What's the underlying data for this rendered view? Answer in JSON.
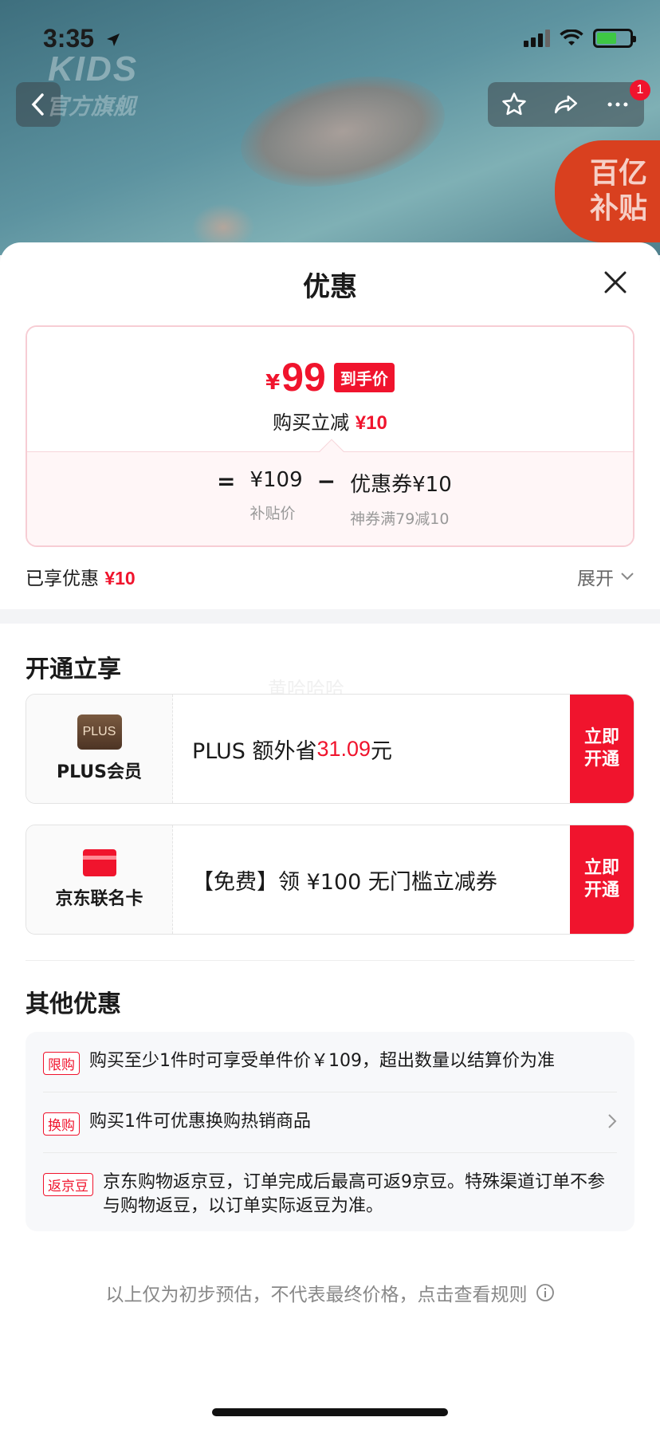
{
  "status_bar": {
    "time": "3:35"
  },
  "background": {
    "brand_text": "KIDS",
    "store_name": "官方旗舰",
    "notification_count": "1",
    "subsidy_badge": [
      "百亿",
      "补贴"
    ]
  },
  "sheet": {
    "title": "优惠",
    "price_card": {
      "yen": "¥",
      "final_price": "99",
      "final_tag": "到手价",
      "instant_cut_label": "购买立减",
      "instant_cut_value": "¥10",
      "equals": "=",
      "base_price": "¥109",
      "base_price_label": "补贴价",
      "minus": "−",
      "coupon": "优惠券¥10",
      "coupon_label": "神券满79减10"
    },
    "enjoyed": {
      "label": "已享优惠",
      "value": "¥10"
    },
    "expand_label": "展开",
    "open_section": {
      "title": "开通立享",
      "watermark": "黄哈哈哈",
      "cards": [
        {
          "name": "PLUS会员",
          "logo_text": "PLUS",
          "desc_pre": "PLUS 额外省 ",
          "desc_red": "31.09",
          "desc_post": " 元",
          "button_line1": "立即",
          "button_line2": "开通"
        },
        {
          "name": "京东联名卡",
          "desc_pre": "【免费】领 ¥100 无门槛立减券",
          "desc_red": "",
          "desc_post": "",
          "button_line1": "立即",
          "button_line2": "开通"
        }
      ]
    },
    "other_section": {
      "title": "其他优惠",
      "items": [
        {
          "tag": "限购",
          "text": "购买至少1件时可享受单件价￥109，超出数量以结算价为准"
        },
        {
          "tag": "换购",
          "text": "购买1件可优惠换购热销商品"
        },
        {
          "tag": "返京豆",
          "text": "京东购物返京豆，订单完成后最高可返9京豆。特殊渠道订单不参与购物返豆，以订单实际返豆为准。"
        }
      ]
    },
    "footer_note": "以上仅为初步预估，不代表最终价格，点击查看规则"
  },
  "colors": {
    "accent_red": "#f0142d",
    "card_border": "#f7cdd4",
    "panel_bg": "#f7f8fa"
  }
}
